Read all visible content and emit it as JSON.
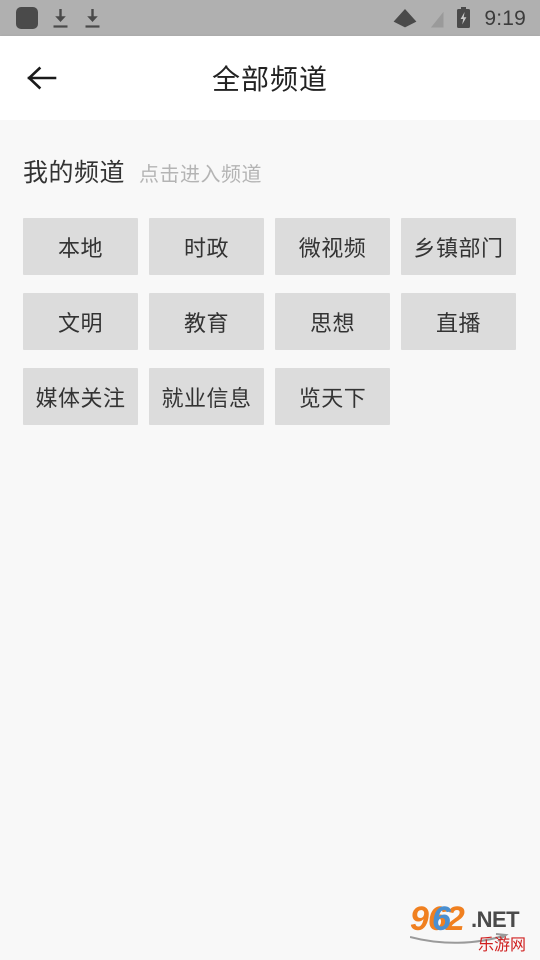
{
  "statusbar": {
    "time": "9:19",
    "left_icons": [
      {
        "name": "app-notification-icon"
      },
      {
        "name": "download-icon"
      },
      {
        "name": "download-icon"
      }
    ],
    "right_icons": [
      {
        "name": "wifi-icon"
      },
      {
        "name": "no-sim-signal-icon"
      },
      {
        "name": "battery-charging-icon"
      }
    ]
  },
  "appbar": {
    "back_label": "back",
    "title": "全部频道"
  },
  "section": {
    "title": "我的频道",
    "hint": "点击进入频道"
  },
  "channels": [
    {
      "label": "本地"
    },
    {
      "label": "时政"
    },
    {
      "label": "微视频"
    },
    {
      "label": "乡镇部门"
    },
    {
      "label": "文明"
    },
    {
      "label": "教育"
    },
    {
      "label": "思想"
    },
    {
      "label": "直播"
    },
    {
      "label": "媒体关注"
    },
    {
      "label": "就业信息"
    },
    {
      "label": "览天下"
    }
  ],
  "watermark": {
    "digits_962": "962",
    "suffix": ".NET",
    "chinese": "乐游网",
    "color_orange": "#f08020",
    "color_blue": "#4a8fd0",
    "color_dark": "#4a4a4a",
    "color_red": "#d02020"
  },
  "colors": {
    "statusbar_bg": "#b0b0b0",
    "appbar_bg": "#ffffff",
    "body_bg": "#f8f8f8",
    "chip_bg": "#dcdcdc",
    "text_primary": "#333333",
    "text_hint": "#b4b4b4"
  }
}
